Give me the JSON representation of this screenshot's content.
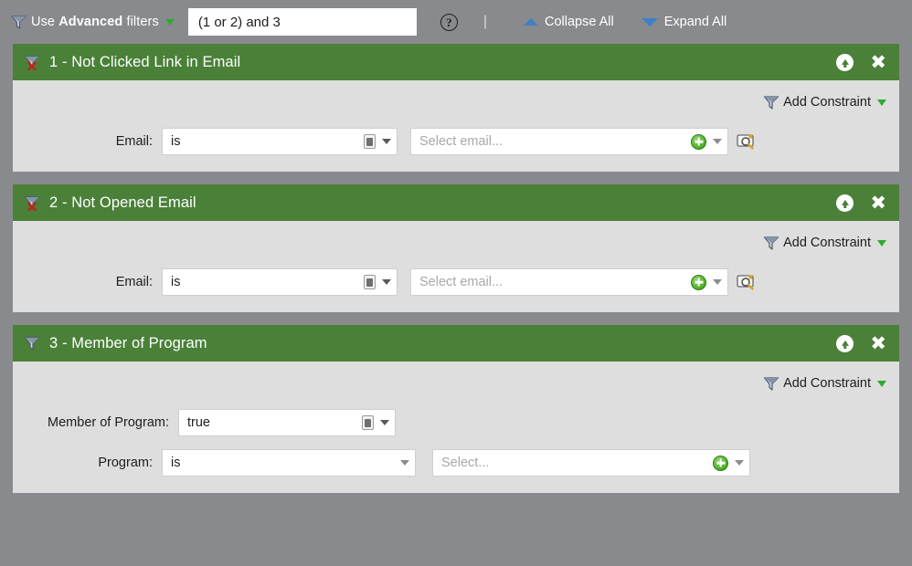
{
  "toolbar": {
    "funnel_icon": "funnel-icon",
    "use_label_prefix": "Use ",
    "use_label_bold": "Advanced",
    "use_label_suffix": " filters",
    "dropdown_icon": "chevron-down-icon",
    "expression_value": "(1 or 2) and 3",
    "expression_placeholder": "",
    "help_icon_label": "?",
    "separator": "|",
    "collapse_all_label": "Collapse All",
    "expand_all_label": "Expand All",
    "collapse_icon": "triangle-up-icon",
    "expand_icon": "triangle-down-icon",
    "background_color": "#898a8e",
    "link_color": "#ffffff",
    "accent_blue": "#3f7fc4",
    "accent_green": "#2faa2f"
  },
  "common": {
    "add_constraint_label": "Add Constraint",
    "move_up_icon": "arrow-up-circle-icon",
    "remove_icon": "close-icon",
    "header_color": "#4a8038",
    "body_color": "#dedede"
  },
  "panels": [
    {
      "number": "1",
      "title": "1 - Not Clicked Link in Email",
      "icon": "funnel-excluded-icon",
      "negated": true,
      "fields": [
        {
          "label": "Email:",
          "operator_value": "is",
          "operator_has_card_icon": true,
          "value_placeholder": "Select email...",
          "value_has_plus": true,
          "has_search_button": true
        }
      ]
    },
    {
      "number": "2",
      "title": "2 - Not Opened Email",
      "icon": "funnel-excluded-icon",
      "negated": true,
      "fields": [
        {
          "label": "Email:",
          "operator_value": "is",
          "operator_has_card_icon": true,
          "value_placeholder": "Select email...",
          "value_has_plus": true,
          "has_search_button": true
        }
      ]
    },
    {
      "number": "3",
      "title": "3 - Member of Program",
      "icon": "funnel-icon",
      "negated": false,
      "fields": [
        {
          "label": "Member of Program:",
          "operator_value": "true",
          "operator_has_card_icon": true,
          "value_placeholder": null,
          "value_has_plus": false,
          "has_search_button": false
        },
        {
          "label": "Program:",
          "operator_value": "is",
          "operator_has_card_icon": false,
          "value_placeholder": "Select...",
          "value_has_plus": true,
          "has_search_button": false
        }
      ]
    }
  ]
}
